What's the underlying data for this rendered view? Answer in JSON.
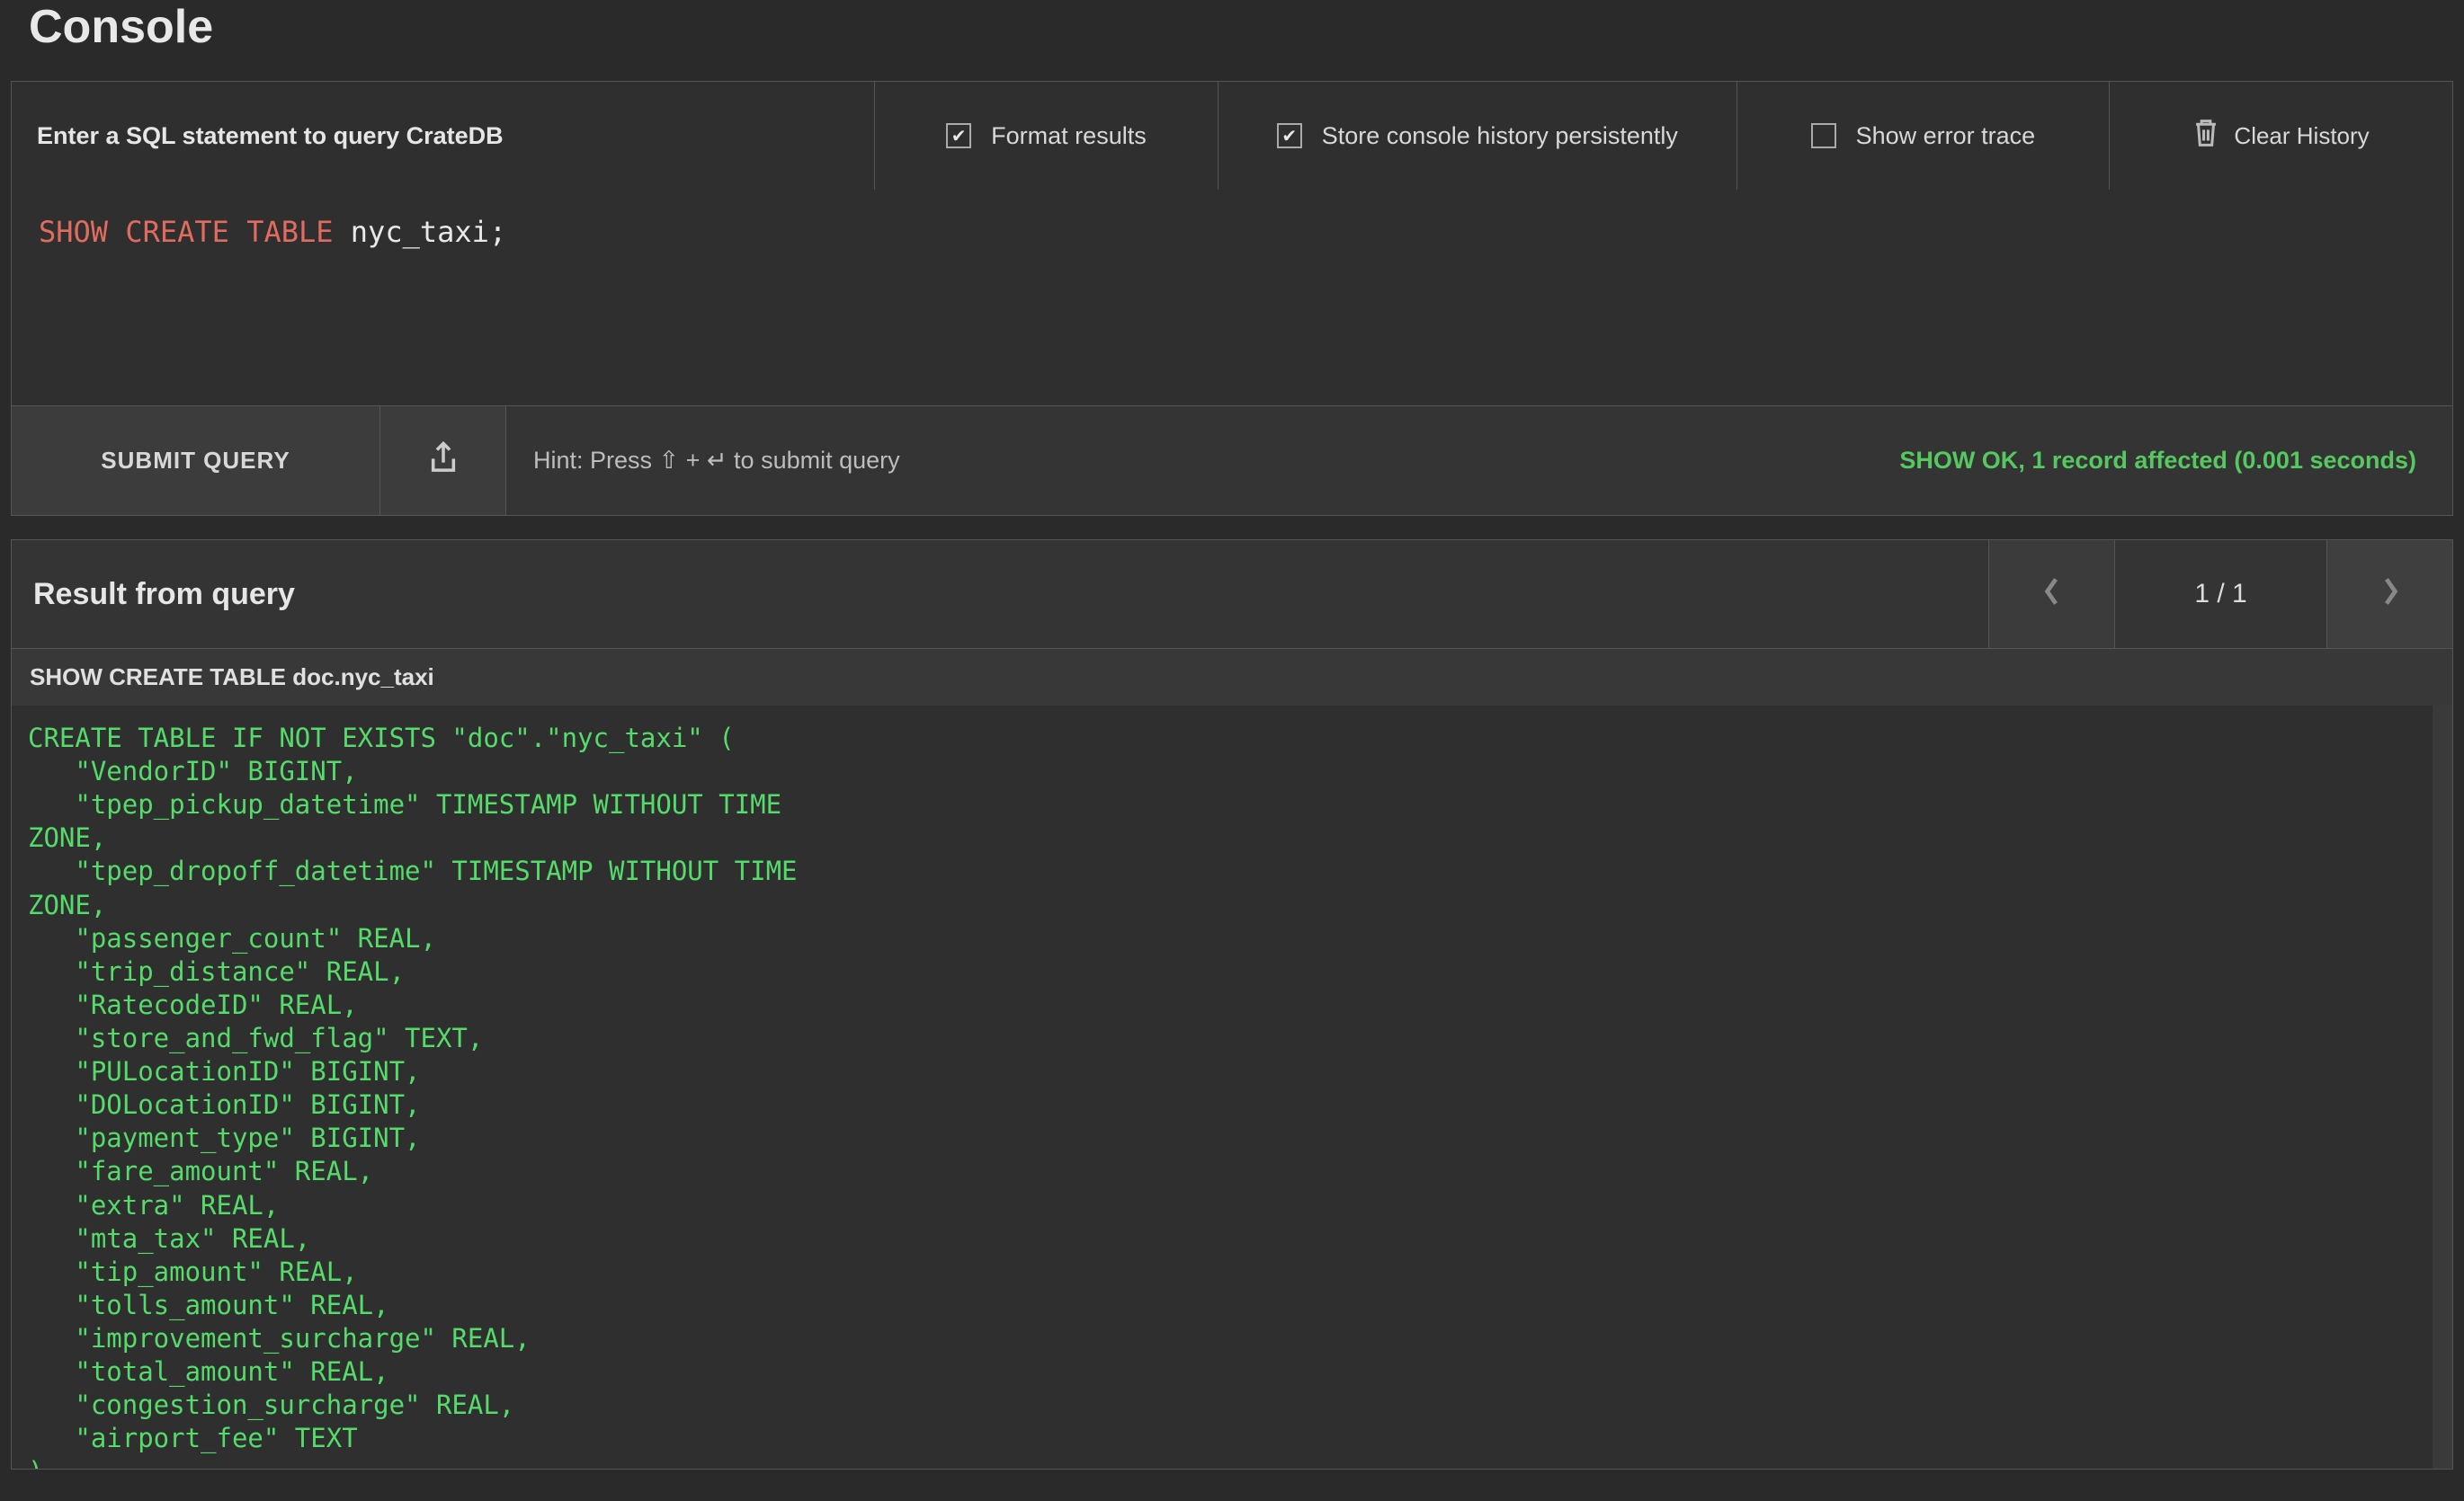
{
  "title": "Console",
  "options": {
    "prompt": "Enter a SQL statement to query CrateDB",
    "format_results": {
      "label": "Format results",
      "checked": true
    },
    "store_history": {
      "label": "Store console history persistently",
      "checked": true
    },
    "error_trace": {
      "label": "Show error trace",
      "checked": false
    },
    "clear_history": "Clear History"
  },
  "editor": {
    "keywords": "SHOW CREATE TABLE",
    "rest": " nyc_taxi;"
  },
  "actions": {
    "submit": "SUBMIT QUERY",
    "hint": "Hint: Press ⇧ + ↵ to submit query",
    "status_ok": "SHOW OK",
    "status_rest": ", 1 record affected (0.001 seconds)"
  },
  "result": {
    "heading": "Result from query",
    "page": "1 / 1",
    "column_header": "SHOW CREATE TABLE doc.nyc_taxi",
    "body": "CREATE TABLE IF NOT EXISTS \"doc\".\"nyc_taxi\" (\n   \"VendorID\" BIGINT,\n   \"tpep_pickup_datetime\" TIMESTAMP WITHOUT TIME\nZONE,\n   \"tpep_dropoff_datetime\" TIMESTAMP WITHOUT TIME\nZONE,\n   \"passenger_count\" REAL,\n   \"trip_distance\" REAL,\n   \"RatecodeID\" REAL,\n   \"store_and_fwd_flag\" TEXT,\n   \"PULocationID\" BIGINT,\n   \"DOLocationID\" BIGINT,\n   \"payment_type\" BIGINT,\n   \"fare_amount\" REAL,\n   \"extra\" REAL,\n   \"mta_tax\" REAL,\n   \"tip_amount\" REAL,\n   \"tolls_amount\" REAL,\n   \"improvement_surcharge\" REAL,\n   \"total_amount\" REAL,\n   \"congestion_surcharge\" REAL,\n   \"airport_fee\" TEXT\n)"
  }
}
